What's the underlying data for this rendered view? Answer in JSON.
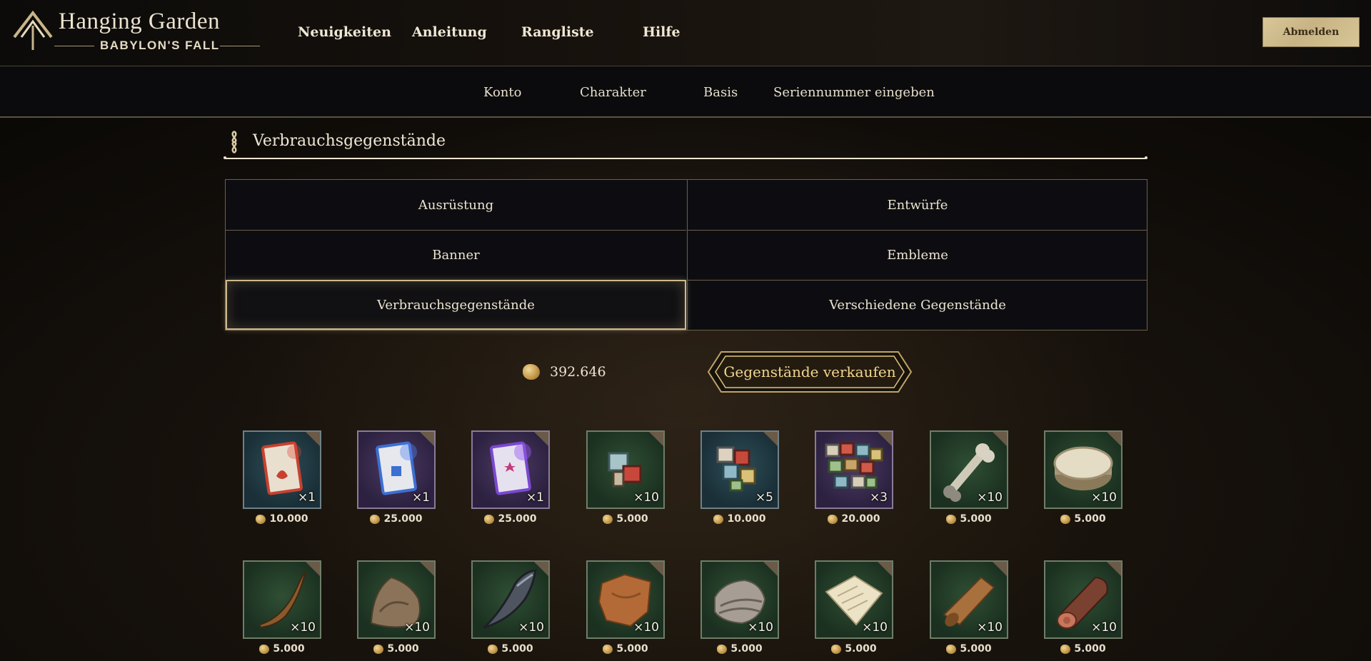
{
  "brand": {
    "title": "Hanging Garden",
    "subtitle": "BABYLON'S FALL"
  },
  "nav": {
    "items": [
      "Neuigkeiten",
      "Anleitung",
      "Rangliste",
      "Hilfe"
    ],
    "logout": "Abmelden"
  },
  "subnav": {
    "items": [
      "Konto",
      "Charakter",
      "Basis",
      "Seriennummer eingeben"
    ]
  },
  "section": {
    "title": "Verbrauchsgegenstände",
    "icon": "ornament-icon"
  },
  "categories": {
    "items": [
      "Ausrüstung",
      "Entwürfe",
      "Banner",
      "Embleme",
      "Verbrauchsgegenstände",
      "Verschiedene Gegenstände"
    ],
    "active": "Verbrauchsgegenstände"
  },
  "currency": {
    "amount": "392.646",
    "icon": "gold-coin-icon"
  },
  "sell_button": {
    "label": "Gegenstände verkaufen"
  },
  "items": [
    {
      "icon": "red-scroll-card-icon",
      "frame": "blue",
      "qty": "×1",
      "price": "10.000"
    },
    {
      "icon": "blue-scroll-card-icon",
      "frame": "purple",
      "qty": "×1",
      "price": "25.000"
    },
    {
      "icon": "violet-scroll-card-icon",
      "frame": "purple",
      "qty": "×1",
      "price": "25.000"
    },
    {
      "icon": "glyph-blocks-small-icon",
      "frame": "green",
      "qty": "×10",
      "price": "5.000"
    },
    {
      "icon": "glyph-blocks-medium-icon",
      "frame": "blue",
      "qty": "×5",
      "price": "10.000"
    },
    {
      "icon": "glyph-blocks-large-icon",
      "frame": "purple",
      "qty": "×3",
      "price": "20.000"
    },
    {
      "icon": "bone-icon",
      "frame": "green",
      "qty": "×10",
      "price": "5.000"
    },
    {
      "icon": "hide-drum-icon",
      "frame": "green",
      "qty": "×10",
      "price": "5.000"
    },
    {
      "icon": "horn-icon",
      "frame": "green",
      "qty": "×10",
      "price": "5.000"
    },
    {
      "icon": "fur-pelt-icon",
      "frame": "green",
      "qty": "×10",
      "price": "5.000"
    },
    {
      "icon": "dark-fang-icon",
      "frame": "green",
      "qty": "×10",
      "price": "5.000"
    },
    {
      "icon": "leather-hide-icon",
      "frame": "green",
      "qty": "×10",
      "price": "5.000"
    },
    {
      "icon": "cloth-bundle-icon",
      "frame": "green",
      "qty": "×10",
      "price": "5.000"
    },
    {
      "icon": "parchment-icon",
      "frame": "green",
      "qty": "×10",
      "price": "5.000"
    },
    {
      "icon": "leather-roll-icon",
      "frame": "green",
      "qty": "×10",
      "price": "5.000"
    },
    {
      "icon": "wood-log-icon",
      "frame": "green",
      "qty": "×10",
      "price": "5.000"
    }
  ]
}
